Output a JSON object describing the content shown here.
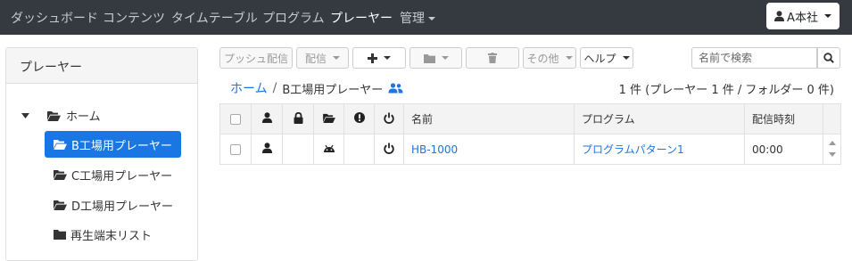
{
  "nav": {
    "items": [
      {
        "label": "ダッシュボード",
        "active": false
      },
      {
        "label": "コンテンツ",
        "active": false
      },
      {
        "label": "タイムテーブル",
        "active": false
      },
      {
        "label": "プログラム",
        "active": false
      },
      {
        "label": "プレーヤー",
        "active": true
      },
      {
        "label": "管理",
        "active": false,
        "dropdown": true
      }
    ],
    "user_label": "A本社"
  },
  "sidebar": {
    "title": "プレーヤー",
    "root_label": "ホーム",
    "items": [
      {
        "label": "B工場用プレーヤー",
        "active": true
      },
      {
        "label": "C工場用プレーヤー",
        "active": false
      },
      {
        "label": "D工場用プレーヤー",
        "active": false
      },
      {
        "label": "再生端末リスト",
        "active": false
      }
    ]
  },
  "toolbar": {
    "push_label": "プッシュ配信",
    "deliver_label": "配信",
    "other_label": "その他",
    "help_label": "ヘルプ",
    "search_placeholder": "名前で検索"
  },
  "breadcrumb": {
    "home": "ホーム",
    "separator": "/",
    "current": "B工場用プレーヤー"
  },
  "summary": "1 件 (プレーヤー 1 件 / フォルダー 0 件)",
  "table": {
    "headers": {
      "name": "名前",
      "program": "プログラム",
      "time": "配信時刻"
    },
    "rows": [
      {
        "name": "HB-1000",
        "program": "プログラムパターン1",
        "time": "00:00"
      }
    ]
  },
  "colors": {
    "accent": "#1a76e3",
    "navbar": "#343a40"
  }
}
